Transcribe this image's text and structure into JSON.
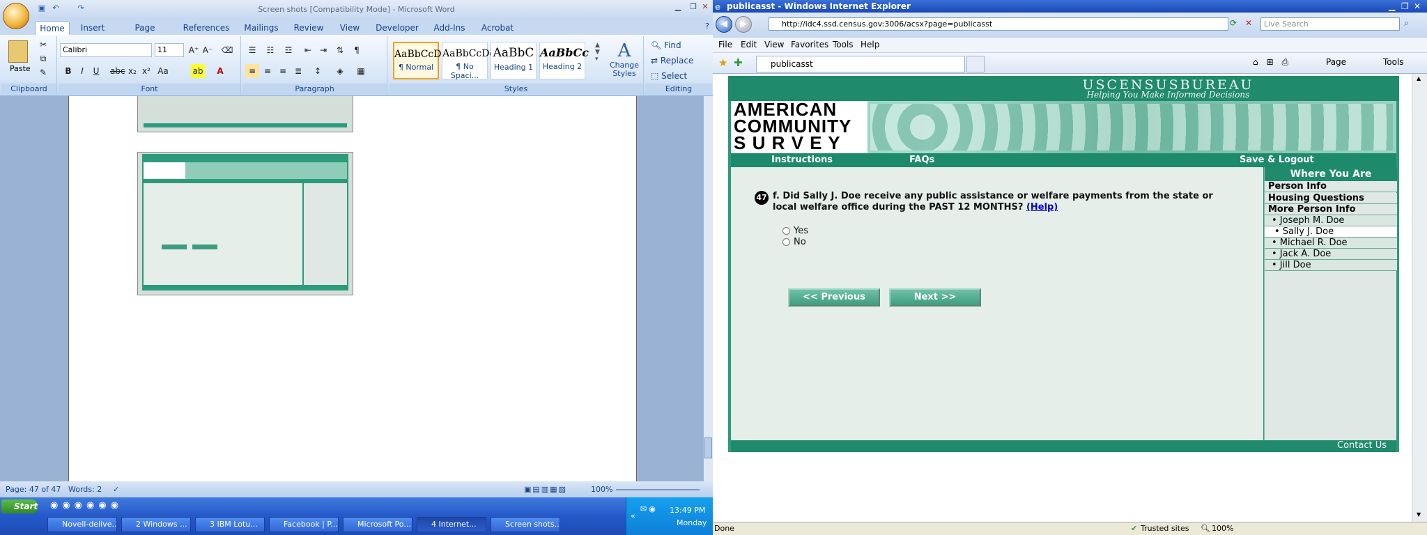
{
  "word": {
    "title": "Screen shots [Compatibility Mode] - Microsoft Word",
    "tabs": [
      "Home",
      "Insert",
      "Page Layout",
      "References",
      "Mailings",
      "Review",
      "View",
      "Developer",
      "Add-Ins",
      "Acrobat"
    ],
    "clipboard": {
      "paste": "Paste",
      "label": "Clipboard"
    },
    "font": {
      "name": "Calibri",
      "size": "11",
      "label": "Font"
    },
    "paragraph_label": "Paragraph",
    "styles": [
      {
        "preview": "AaBbCcDc",
        "name": "¶ Normal"
      },
      {
        "preview": "AaBbCcDc",
        "name": "¶ No Spaci..."
      },
      {
        "preview": "AaBbC",
        "name": "Heading 1"
      },
      {
        "preview": "AaBbCc",
        "name": "Heading 2"
      }
    ],
    "change_styles": "Change Styles",
    "styles_label": "Styles",
    "editing": {
      "find": "Find",
      "replace": "Replace",
      "select": "Select",
      "label": "Editing"
    },
    "status": {
      "page": "Page: 47 of 47",
      "words": "Words: 2",
      "zoom": "100%"
    }
  },
  "ie": {
    "title": "publicasst - Windows Internet Explorer",
    "url": "http://idc4.ssd.census.gov:3006/acsx?page=publicasst",
    "search_placeholder": "Live Search",
    "menu": [
      "File",
      "Edit",
      "View",
      "Favorites",
      "Tools",
      "Help"
    ],
    "tab_title": "publicasst",
    "toolbar": {
      "page": "Page",
      "tools": "Tools"
    },
    "status": {
      "done": "Done",
      "zone": "Trusted sites",
      "zoom": "100%"
    }
  },
  "census": {
    "band_title": "USCENSUSBUREAU",
    "band_sub": "Helping You Make Informed Decisions",
    "logo": [
      "AMERICAN",
      "COMMUNITY",
      "S U R V E Y"
    ],
    "nav": {
      "instructions": "Instructions",
      "faqs": "FAQs",
      "save": "Save & Logout"
    },
    "question": {
      "number": "47",
      "text": "f. Did Sally J. Doe receive any public assistance or welfare payments from the state or local welfare office during the PAST 12 MONTHS?",
      "help": "(Help)"
    },
    "options": [
      "Yes",
      "No"
    ],
    "buttons": {
      "previous": "<<   Previous",
      "next": "Next   >>"
    },
    "sidebar": {
      "heading": "Where You Are",
      "sections": [
        "Person Info",
        "Housing Questions",
        "More Person Info"
      ],
      "people": [
        "• Joseph M. Doe",
        "• Sally J. Doe",
        "• Michael R. Doe",
        "• Jack A. Doe",
        "• Jill Doe"
      ]
    },
    "footer": "Contact Us"
  },
  "taskbar": {
    "start": "Start",
    "tasks": [
      "Novell-delive...",
      "2 Windows ...",
      "3 IBM Lotu...",
      "Facebook | P...",
      "Microsoft Po...",
      "4 Internet...",
      "Screen shots..."
    ],
    "time": "13:49 PM",
    "day": "Monday"
  }
}
